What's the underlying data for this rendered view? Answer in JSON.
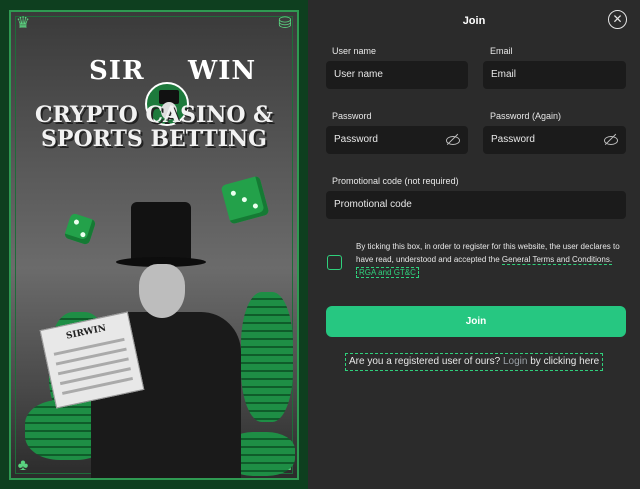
{
  "promo": {
    "brand_left": "SIR",
    "brand_right": "WIN",
    "headline_line1": "CRYPTO CASINO &",
    "headline_line2": "SPORTS BETTING",
    "paper_title": "SIRWIN"
  },
  "modal": {
    "title": "Join",
    "close_icon": "close-icon"
  },
  "form": {
    "username": {
      "label": "User name",
      "placeholder": "User name"
    },
    "email": {
      "label": "Email",
      "placeholder": "Email"
    },
    "password": {
      "label": "Password",
      "placeholder": "Password"
    },
    "password_again": {
      "label": "Password (Again)",
      "placeholder": "Password"
    },
    "promo_code": {
      "label": "Promotional code (not required)",
      "placeholder": "Promotional code"
    },
    "terms_text": "By ticking this box, in order to register for this website, the user declares to have read, understood and accepted the",
    "terms_link_text": "General Terms and Conditions.",
    "terms_link2": "RGA and GT&C",
    "join_button": "Join",
    "login_prompt": "Are you a registered user of ours?",
    "login_link": "Login",
    "login_suffix": "by clicking here"
  },
  "colors": {
    "accent": "#26c781",
    "panel_bg": "#2b2b2b",
    "input_bg": "#1b1b1b",
    "promo_green": "#0e3f1f"
  }
}
